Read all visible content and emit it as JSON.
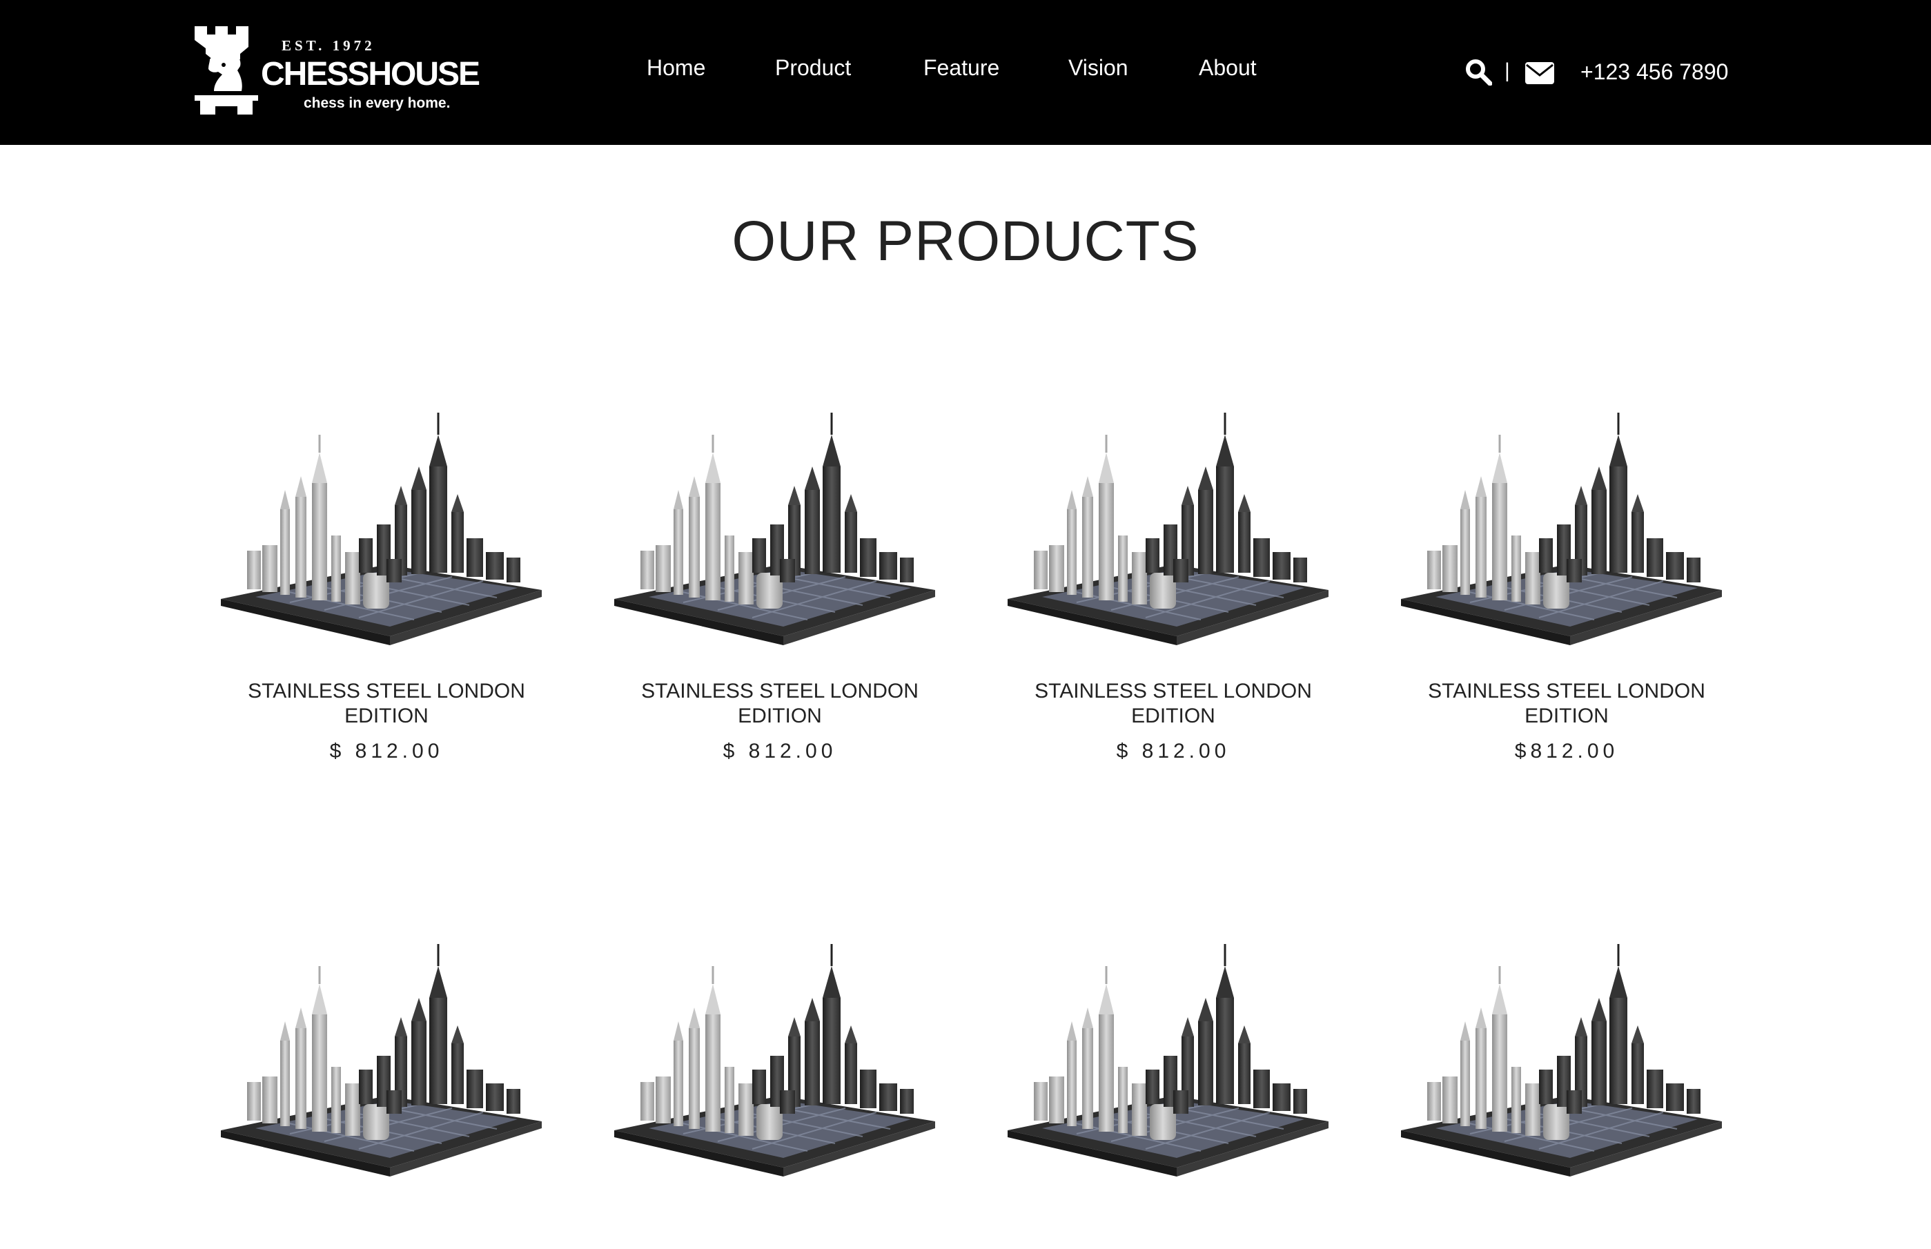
{
  "brand": {
    "est": "EST. 1972",
    "name": "CHESSHOUSE",
    "tagline": "chess in every home."
  },
  "nav": {
    "items": [
      {
        "label": "Home"
      },
      {
        "label": "Product"
      },
      {
        "label": "Feature"
      },
      {
        "label": "Vision"
      },
      {
        "label": "About"
      }
    ]
  },
  "contact": {
    "search_icon": "search-icon",
    "divider": "|",
    "mail_icon": "envelope-icon",
    "phone": "+123 456 7890"
  },
  "page": {
    "title": "OUR PRODUCTS"
  },
  "products": [
    {
      "name": "STAINLESS STEEL LONDON EDITION",
      "price": "$ 812.00"
    },
    {
      "name": "STAINLESS STEEL LONDON EDITION",
      "price": "$ 812.00"
    },
    {
      "name": "STAINLESS STEEL LONDON EDITION",
      "price": "$ 812.00"
    },
    {
      "name": "STAINLESS STEEL LONDON EDITION",
      "price": "$812.00"
    },
    {
      "name": "",
      "price": ""
    },
    {
      "name": "",
      "price": ""
    },
    {
      "name": "",
      "price": ""
    },
    {
      "name": "",
      "price": ""
    }
  ],
  "colors": {
    "header_bg": "#000000",
    "header_text": "#ffffff",
    "body_bg": "#ffffff",
    "text": "#222222"
  }
}
